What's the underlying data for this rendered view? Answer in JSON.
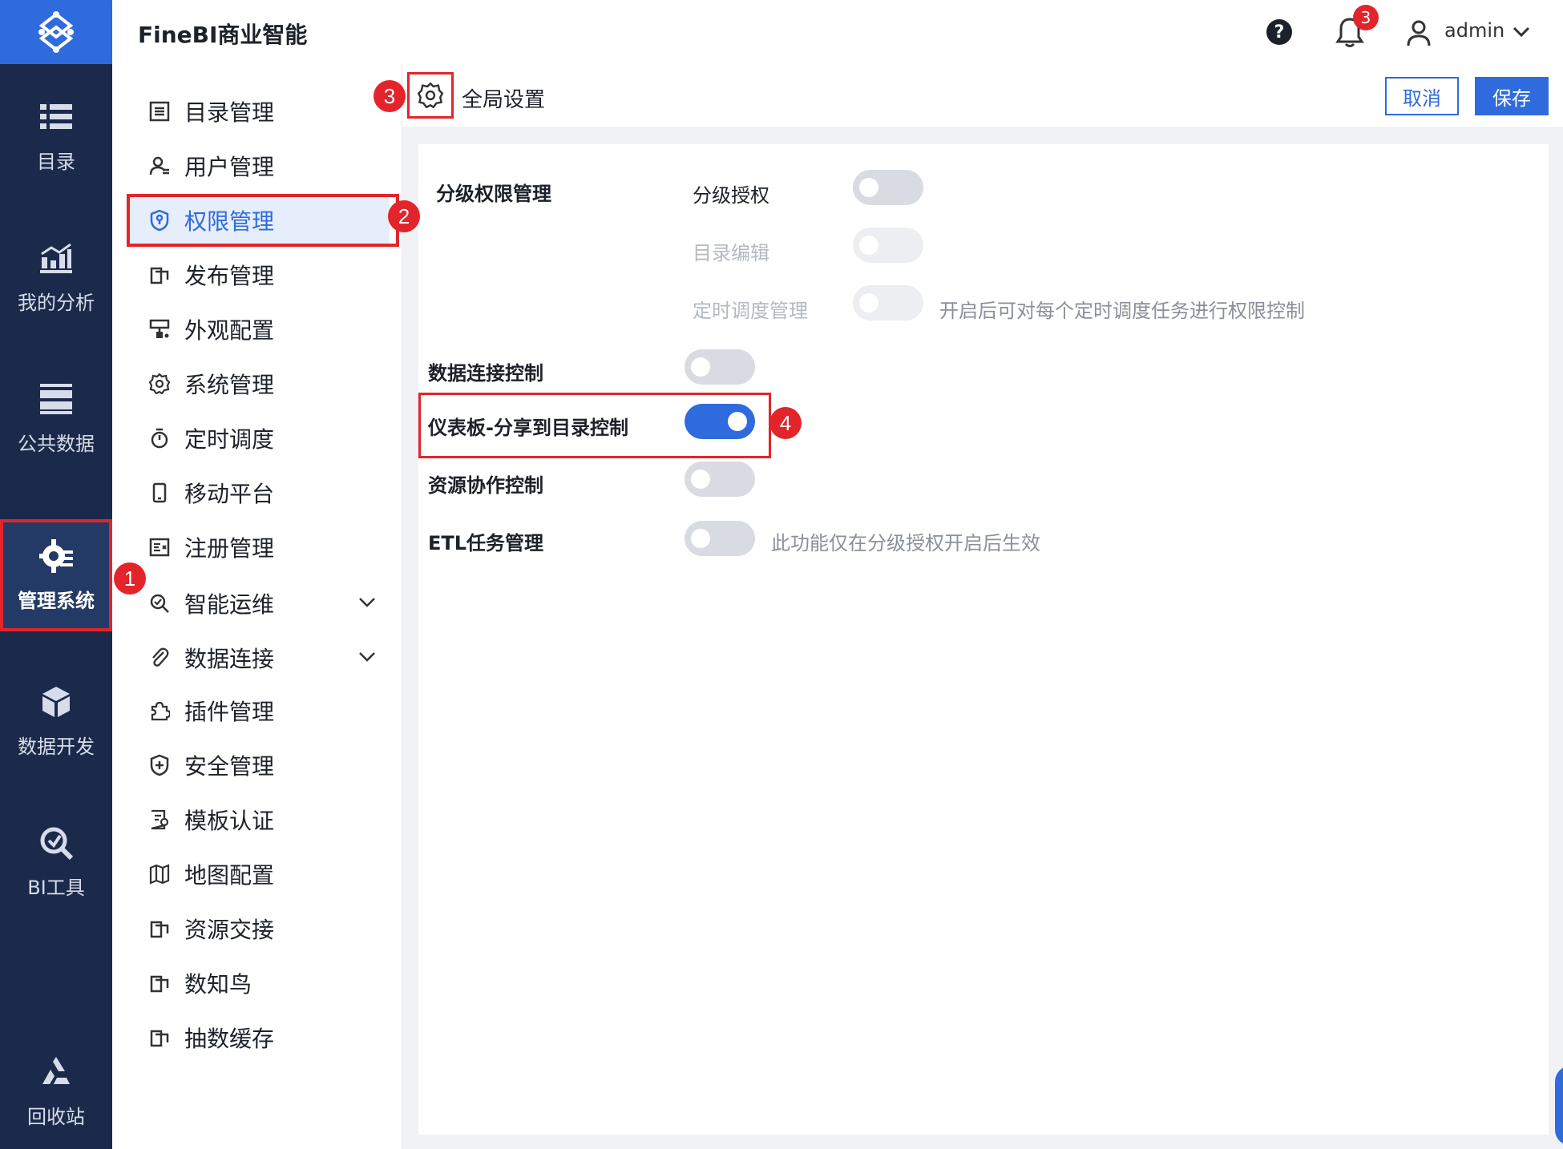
{
  "header": {
    "app_title": "FineBI商业智能",
    "help_label": "?",
    "notification_count": "3",
    "user_name": "admin"
  },
  "rail": {
    "items": [
      {
        "label": "目录",
        "icon": "list-icon"
      },
      {
        "label": "我的分析",
        "icon": "chart-icon"
      },
      {
        "label": "公共数据",
        "icon": "database-icon"
      },
      {
        "label": "管理系统",
        "icon": "gear-manage-icon",
        "active": true
      },
      {
        "label": "数据开发",
        "icon": "cubes-icon"
      },
      {
        "label": "BI工具",
        "icon": "tool-icon"
      },
      {
        "label": "回收站",
        "icon": "recycle-icon"
      }
    ]
  },
  "sidebar": {
    "items": [
      {
        "label": "目录管理",
        "icon": "catalog-icon"
      },
      {
        "label": "用户管理",
        "icon": "user-icon"
      },
      {
        "label": "权限管理",
        "icon": "shield-lock-icon",
        "active": true
      },
      {
        "label": "发布管理",
        "icon": "copy-icon"
      },
      {
        "label": "外观配置",
        "icon": "brush-icon"
      },
      {
        "label": "系统管理",
        "icon": "gear-icon"
      },
      {
        "label": "定时调度",
        "icon": "timer-icon"
      },
      {
        "label": "移动平台",
        "icon": "phone-icon"
      },
      {
        "label": "注册管理",
        "icon": "register-icon"
      },
      {
        "label": "智能运维",
        "icon": "ops-icon",
        "expandable": true
      },
      {
        "label": "数据连接",
        "icon": "paperclip-icon",
        "expandable": true
      },
      {
        "label": "插件管理",
        "icon": "puzzle-icon"
      },
      {
        "label": "安全管理",
        "icon": "shield-plus-icon"
      },
      {
        "label": "模板认证",
        "icon": "certificate-icon"
      },
      {
        "label": "地图配置",
        "icon": "map-icon"
      },
      {
        "label": "资源交接",
        "icon": "copy-icon"
      },
      {
        "label": "数知鸟",
        "icon": "copy-icon"
      },
      {
        "label": "抽数缓存",
        "icon": "copy-icon"
      }
    ]
  },
  "content": {
    "title": "全局设置",
    "cancel_label": "取消",
    "save_label": "保存",
    "section_title": "分级权限管理",
    "sub_settings": [
      {
        "label": "分级授权",
        "enabled": false,
        "disabled": false
      },
      {
        "label": "目录编辑",
        "enabled": false,
        "disabled": true
      },
      {
        "label": "定时调度管理",
        "enabled": false,
        "disabled": true,
        "hint": "开启后可对每个定时调度任务进行权限控制"
      }
    ],
    "settings": [
      {
        "label": "数据连接控制",
        "enabled": false
      },
      {
        "label": "仪表板-分享到目录控制",
        "enabled": true
      },
      {
        "label": "资源协作控制",
        "enabled": false
      },
      {
        "label": "ETL任务管理",
        "enabled": false,
        "hint": "此功能仅在分级授权开启后生效"
      }
    ]
  },
  "markers": [
    "1",
    "2",
    "3",
    "4"
  ],
  "colors": {
    "rail_bg": "#1b2a4a",
    "brand_blue": "#2f6bdc",
    "annotation_red": "#e3242b",
    "toggle_off": "#d8dbe2"
  }
}
